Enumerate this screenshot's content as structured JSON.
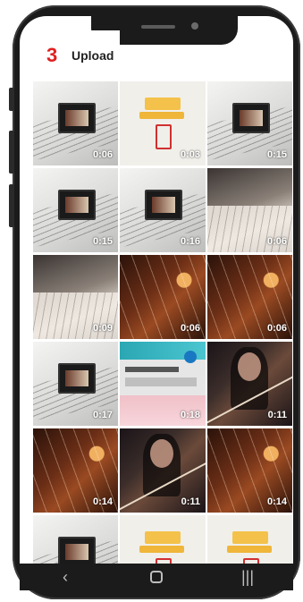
{
  "step": {
    "number": "3",
    "title": "Upload"
  },
  "gallery": {
    "items": [
      {
        "kind": "sheet",
        "duration": "0:06"
      },
      {
        "kind": "promo",
        "duration": "0:03"
      },
      {
        "kind": "sheet",
        "duration": "0:15"
      },
      {
        "kind": "sheet",
        "duration": "0:15"
      },
      {
        "kind": "sheet",
        "duration": "0:16"
      },
      {
        "kind": "keys",
        "duration": "0:06"
      },
      {
        "kind": "keys",
        "duration": "0:09"
      },
      {
        "kind": "cello",
        "duration": "0:06"
      },
      {
        "kind": "cello",
        "duration": "0:06"
      },
      {
        "kind": "sheet",
        "duration": "0:17"
      },
      {
        "kind": "app",
        "duration": "0:18"
      },
      {
        "kind": "violin",
        "duration": "0:11"
      },
      {
        "kind": "cello",
        "duration": "0:14"
      },
      {
        "kind": "violin",
        "duration": "0:11"
      },
      {
        "kind": "cello",
        "duration": "0:14"
      },
      {
        "kind": "sheet",
        "duration": ""
      },
      {
        "kind": "promo",
        "duration": ""
      },
      {
        "kind": "promo",
        "duration": ""
      }
    ]
  },
  "nav": {
    "back": "‹",
    "recents": "|||"
  },
  "colors": {
    "accent_red": "#e02020",
    "frame": "#1b1b1b"
  }
}
